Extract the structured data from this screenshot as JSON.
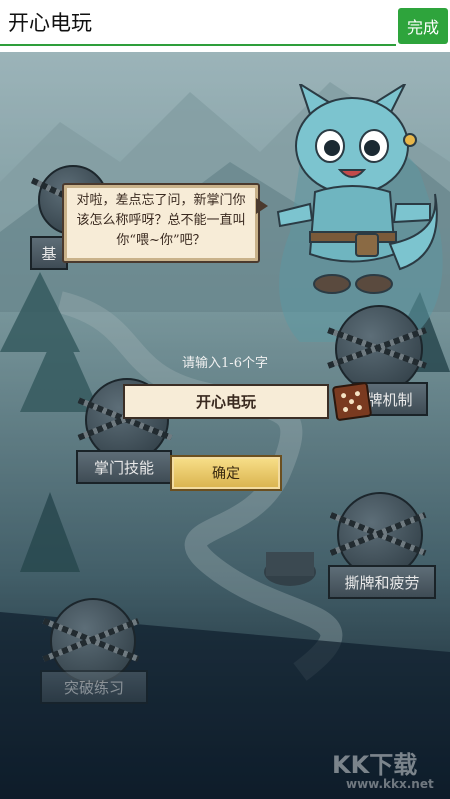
{
  "input": {
    "value": "开心电玩"
  },
  "done_button": {
    "label": "完成"
  },
  "dialog": {
    "text": "对啦，差点忘了问，新掌门你该怎么称呼呀？总不能一直叫你“喂~你”吧？"
  },
  "name_prompt": "请输入1-6个字",
  "name_value": "开心电玩",
  "confirm_label": "确定",
  "map_nodes": {
    "node_top_left": "基",
    "node_right": "牌机制",
    "node_mid": "掌门技能",
    "node_lower_right": "撕牌和疲劳",
    "node_bottom": "突破练习"
  },
  "watermark": {
    "main": "KK下载",
    "sub": "www.kkx.net"
  },
  "colors": {
    "accent_green": "#2ea43c",
    "parchment": "#f7ecd7",
    "gold_button": "#d9b24d"
  }
}
